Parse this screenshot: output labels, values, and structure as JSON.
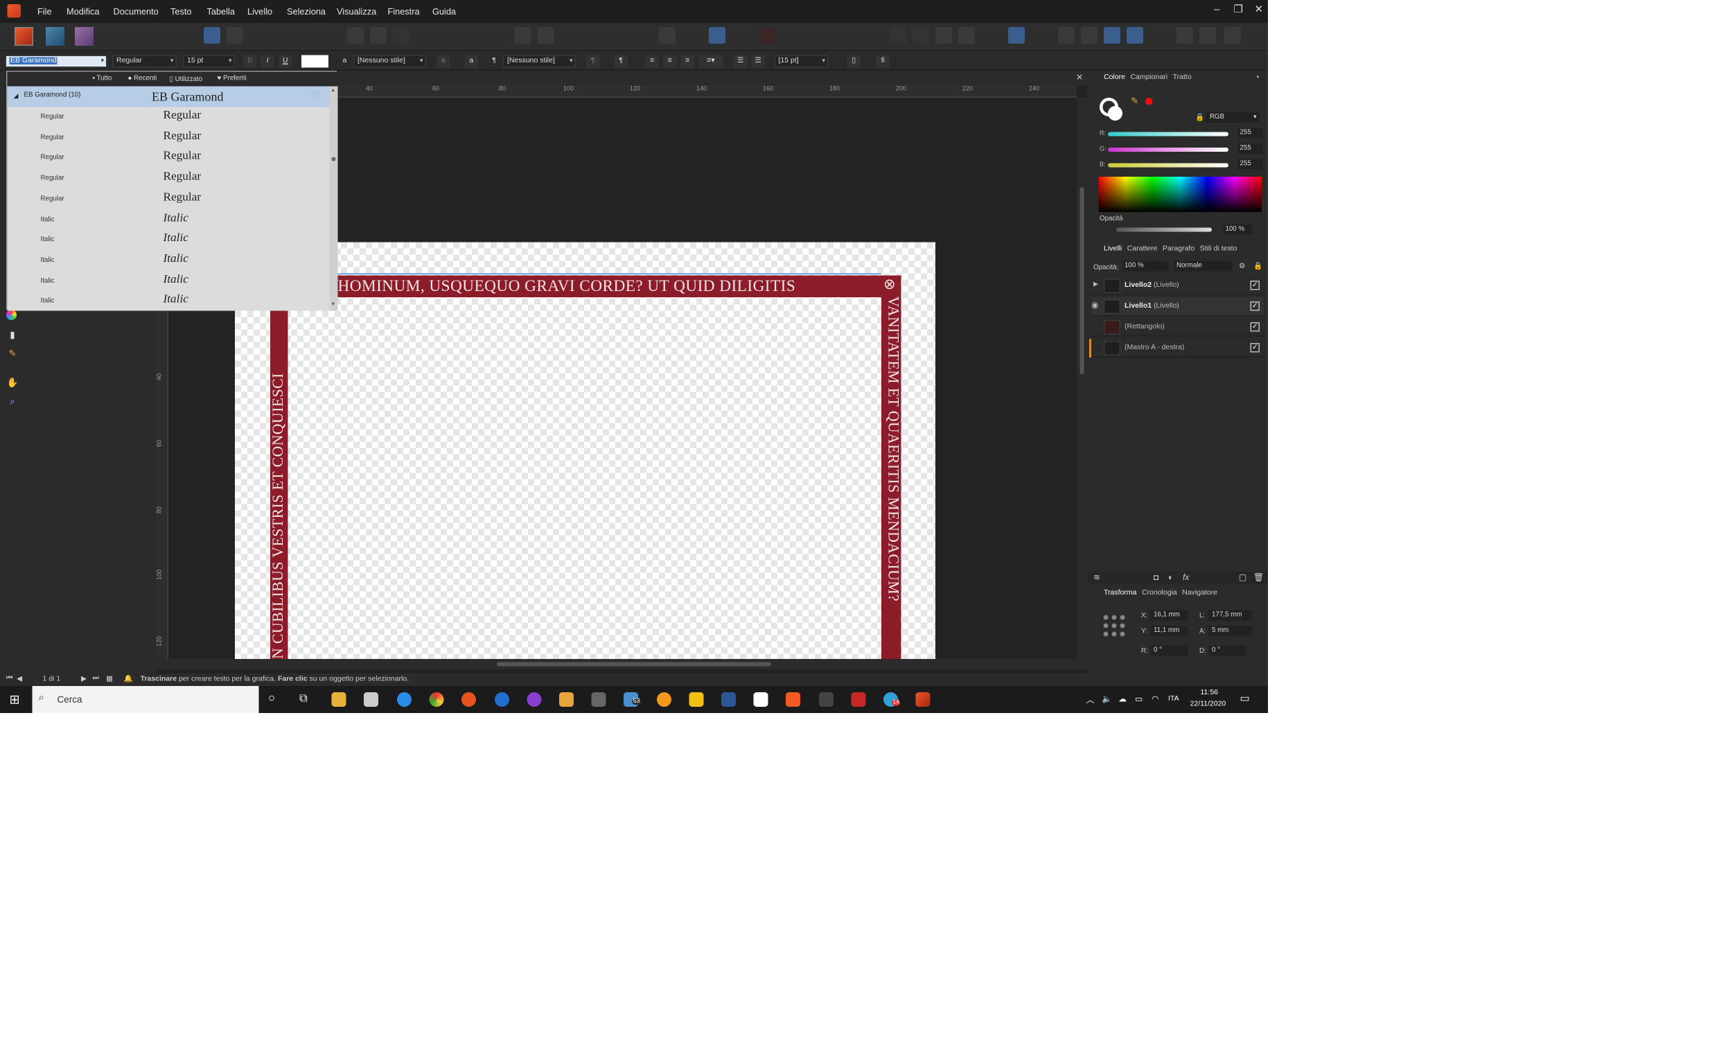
{
  "menubar": {
    "items": [
      "File",
      "Modifica",
      "Documento",
      "Testo",
      "Tabella",
      "Livello",
      "Seleziona",
      "Visualizza",
      "Finestra",
      "Guida"
    ]
  },
  "context": {
    "font_family": "EB Garamond",
    "font_style": "Regular",
    "font_size": "15 pt",
    "char_style": "[Nessuno stile]",
    "para_style": "[Nessuno stile]",
    "leading": "[15 pt]"
  },
  "font_panel": {
    "tabs": [
      "Tutto",
      "Recenti",
      "Utilizzato",
      "Preferiti"
    ],
    "family_label": "EB Garamond (10)",
    "family_preview": "EB Garamond",
    "rows": [
      {
        "style": "Regular",
        "preview": "Regular"
      },
      {
        "style": "Regular",
        "preview": "Regular"
      },
      {
        "style": "Regular",
        "preview": "Regular"
      },
      {
        "style": "Regular",
        "preview": "Regular"
      },
      {
        "style": "Regular",
        "preview": "Regular"
      },
      {
        "style": "Italic",
        "preview": "Italic"
      },
      {
        "style": "Italic",
        "preview": "Italic"
      },
      {
        "style": "Italic",
        "preview": "Italic"
      },
      {
        "style": "Italic",
        "preview": "Italic"
      },
      {
        "style": "Italic",
        "preview": "Italic"
      }
    ]
  },
  "ruler": {
    "h_ticks": [
      "40",
      "60",
      "80",
      "100",
      "120",
      "140",
      "160",
      "180",
      "200",
      "220",
      "240"
    ],
    "v_ticks": [
      "40",
      "60",
      "80",
      "100",
      "120"
    ]
  },
  "document": {
    "top_text": "HOMINUM, USQUEQUO GRAVI CORDE? UT QUID DILIGITIS",
    "left_text": "N CUBILIBUS VESTRIS ET CONQUIESCI",
    "right_text": "VANITATEM ET QUAERITIS MENDACIUM?",
    "corner_glyph": "⊗"
  },
  "status": {
    "page": "1 di 1",
    "bold1": "Trascinare",
    "text1": " per creare testo per la grafica. ",
    "bold2": "Fare clic",
    "text2": " su un oggetto per selezionarlo."
  },
  "color_panel": {
    "tabs": [
      "Colore",
      "Campionari",
      "Tratto"
    ],
    "model": "RGB",
    "r_label": "R:",
    "r": "255",
    "g_label": "G:",
    "g": "255",
    "b_label": "B:",
    "b": "255",
    "opacity_label": "Opacità",
    "opacity": "100 %"
  },
  "layers_panel": {
    "tabs": [
      "Livelli",
      "Carattere",
      "Paragrafo",
      "Stili di testo"
    ],
    "opacity_label": "Opacità:",
    "opacity": "100 %",
    "blend": "Normale",
    "layers": [
      {
        "name": "Livello2",
        "type": " (Livello)",
        "bold": true
      },
      {
        "name": "Livello1",
        "type": " (Livello)",
        "bold": true
      },
      {
        "name": "",
        "type": "(Rettangolo)",
        "bold": false
      },
      {
        "name": "",
        "type": "(Mastro A - destra)",
        "bold": false
      }
    ]
  },
  "transform_panel": {
    "tabs": [
      "Trasforma",
      "Cronologia",
      "Navigatore"
    ],
    "x_label": "X:",
    "x": "16,1 mm",
    "y_label": "Y:",
    "y": "11,1 mm",
    "w_label": "L:",
    "w": "177,5 mm",
    "h_label": "A:",
    "h": "5 mm",
    "r_label": "R:",
    "r": "0 °",
    "s_label": "D:",
    "s": "0 °"
  },
  "taskbar": {
    "search_placeholder": "Cerca",
    "mail_badge": "53",
    "telegram_badge": "14",
    "lang": "ITA",
    "time": "11:56",
    "date": "22/11/2020"
  },
  "colors": {
    "accent_band": "#8c1c2a",
    "selection": "#b7cde6",
    "dark_bg": "#2b2b2b"
  }
}
